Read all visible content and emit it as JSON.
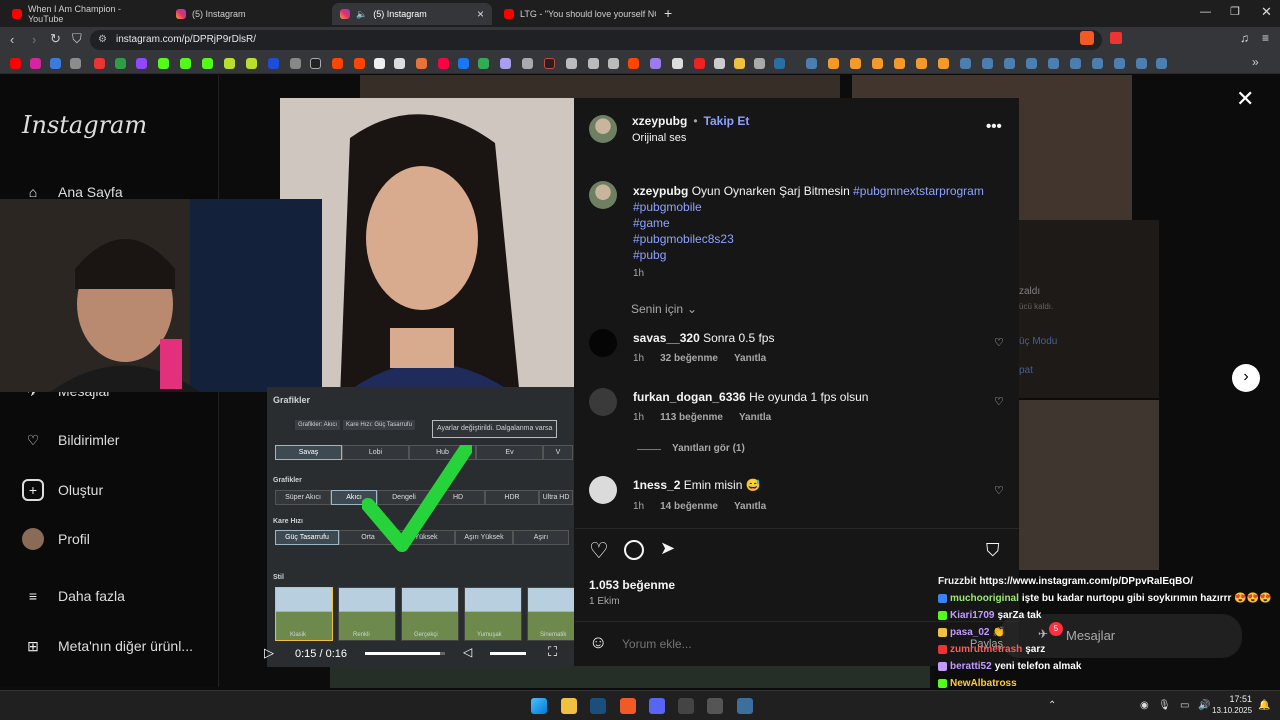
{
  "browser": {
    "tabs": [
      {
        "title": "When I Am Champion - YouTube",
        "favicon": "youtube-icon"
      },
      {
        "title": "(5) Instagram",
        "favicon": "instagram-icon"
      },
      {
        "title": "(5) Instagram",
        "favicon": "instagram-icon",
        "active": true
      },
      {
        "title": "LTG - \"You should love yourself NOW",
        "favicon": "youtube-icon"
      }
    ],
    "url": "instagram.com/p/DPRjP9rDlsR/"
  },
  "sidebar": {
    "logo": "Instagram",
    "items": [
      {
        "label": "Ana Sayfa",
        "icon": "home-icon"
      },
      {
        "label": "Mesajlar",
        "icon": "messages-icon"
      },
      {
        "label": "Bildirimler",
        "icon": "heart-icon"
      },
      {
        "label": "Oluştur",
        "icon": "plus-icon"
      },
      {
        "label": "Profil",
        "icon": "avatar"
      },
      {
        "label": "Daha fazla",
        "icon": "menu-icon"
      },
      {
        "label": "Meta'nın diğer ürünl...",
        "icon": "grid-icon"
      }
    ]
  },
  "background_tiles": {
    "fragments": [
      "zaldı",
      "ücü kaldı.",
      "üç Modu",
      "pat"
    ]
  },
  "post": {
    "author": "xzeypubg",
    "dot": "•",
    "follow": "Takip Et",
    "audio": "Orijinal ses",
    "caption_user": "xzeypubg",
    "caption_text": "Oyun Oynarken Şarj Bitmesin",
    "hashtags": [
      "#pubgmnextstarprogram",
      "#pubgmobile",
      "#game",
      "#pubgmobilec8s23",
      "#pubg"
    ],
    "caption_time": "1h",
    "sort_label": "Senin için",
    "comments": [
      {
        "user": "savas__320",
        "text": "Sonra 0.5 fps",
        "time": "1h",
        "likes": "32 beğenme",
        "reply": "Yanıtla"
      },
      {
        "user": "furkan_dogan_6336",
        "text": "He oyunda 1 fps olsun",
        "time": "1h",
        "likes": "113 beğenme",
        "reply": "Yanıtla"
      },
      {
        "user": "1ness_2",
        "text": "Emin misin 😅",
        "time": "1h",
        "likes": "14 beğenme",
        "reply": "Yanıtla"
      }
    ],
    "view_replies": "Yanıtları gör (1)",
    "likes_count": "1.053 beğenme",
    "date": "1 Ekim",
    "comment_placeholder": "Yorum ekle...",
    "video_time": "0:15 / 0:16",
    "progress": 0.94
  },
  "game_overlay": {
    "title": "Grafikler",
    "notice": "Ayarlar değiştirildi. Dalgalanma varsa",
    "tabs": [
      "Savaş",
      "Lobi",
      "Hub",
      "Ev",
      "V"
    ],
    "graphics_label": "Grafikler",
    "graphics_opts": [
      "Süper Akıcı",
      "Akıcı",
      "Dengeli",
      "HD",
      "HDR",
      "Ultra HD"
    ],
    "fps_label": "Kare Hızı",
    "fps_opts": [
      "Güç Tasarrufu",
      "Orta",
      "Yüksek",
      "Aşırı Yüksek",
      "Aşırı"
    ],
    "style_label": "Stil",
    "styles": [
      "Klasik",
      "Renkli",
      "Gerçekçi",
      "Yumuşak",
      "Sinematik"
    ],
    "top_chips": [
      "Grafikler: Akıcı",
      "Kare Hızı: Güç Tasarrufu"
    ]
  },
  "chat": [
    {
      "user": "Fruzzbit",
      "text": "https://www.instagram.com/p/DPpvRaIEqBO/",
      "color": "#f5f5f5"
    },
    {
      "user": "muchooriginal",
      "text": "işte bu kadar nurtopu gibi soykırımın hazırrr 😍😍😍",
      "color": "#9fe870"
    },
    {
      "user": "Kiari1709",
      "text": "şarZa tak",
      "color": "#c39bff"
    },
    {
      "user": "pasa_02",
      "text": "👏",
      "color": "#c39bff"
    },
    {
      "user": "zumrutmetrash",
      "text": "şarz",
      "color": "#ff5a5a"
    },
    {
      "user": "beratti52",
      "text": "yeni telefon almak",
      "color": "#c39bff"
    },
    {
      "user": "NewAlbatross",
      "text": "",
      "color": "#ffcc33"
    }
  ],
  "popup": {
    "messages": "Mesajlar",
    "share": "Paylaş",
    "notif_count": "5"
  },
  "taskbar": {
    "time": "17:51",
    "date": "13.10.2025"
  }
}
